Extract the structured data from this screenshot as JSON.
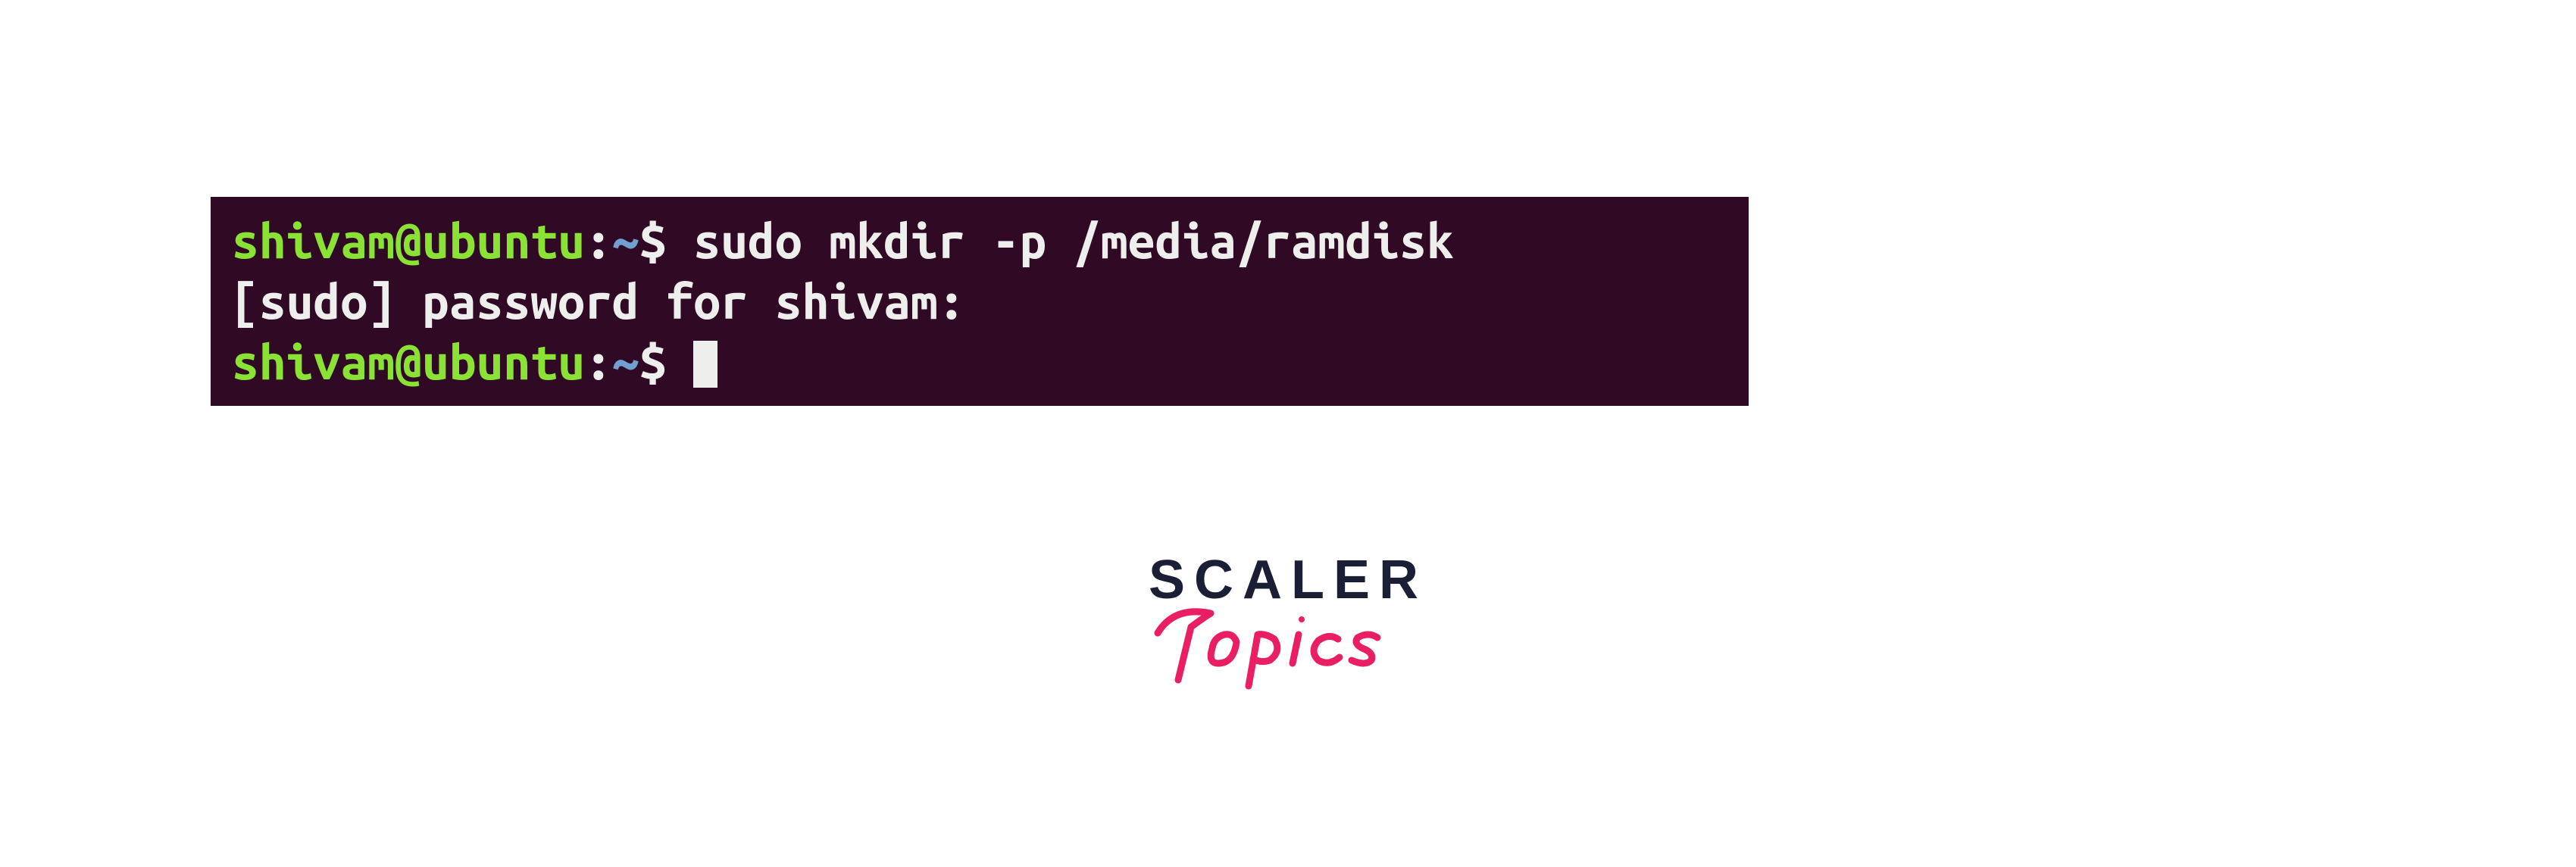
{
  "terminal": {
    "bg": "#300a24",
    "lines": [
      {
        "user_host": "shivam@ubuntu",
        "colon": ":",
        "path": "~",
        "dollar": "$",
        "command": " sudo mkdir -p /media/ramdisk"
      },
      {
        "output": "[sudo] password for shivam:"
      },
      {
        "user_host": "shivam@ubuntu",
        "colon": ":",
        "path": "~",
        "dollar": "$",
        "command": " ",
        "cursor": true
      }
    ]
  },
  "logo": {
    "scaler": "SCALER",
    "topics": "Topics",
    "scaler_color": "#1a1f36",
    "topics_color": "#e91e63"
  }
}
